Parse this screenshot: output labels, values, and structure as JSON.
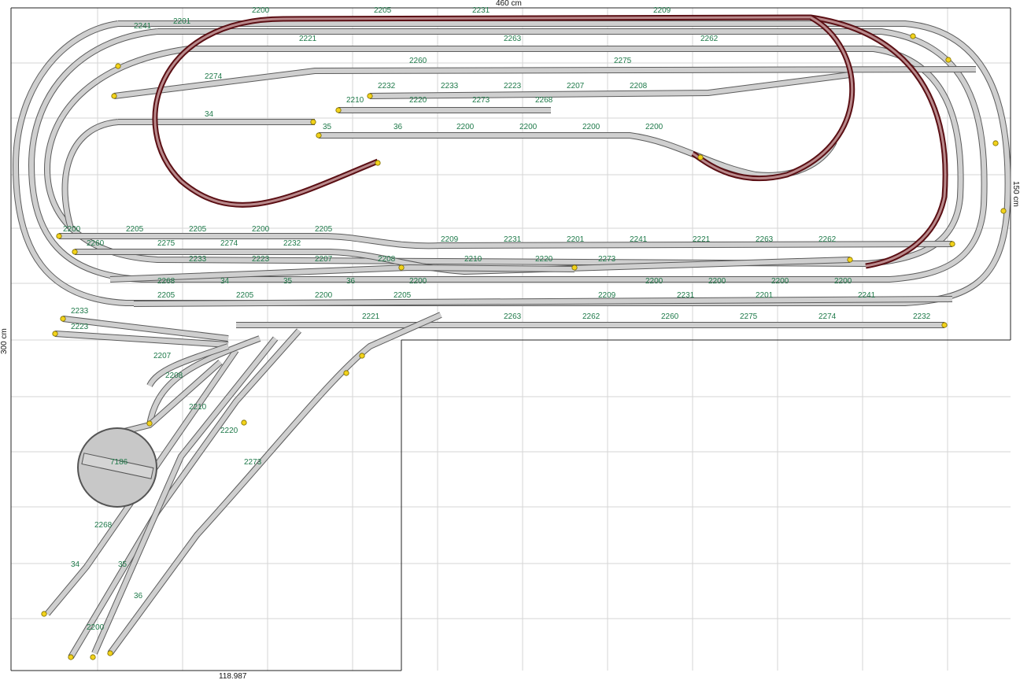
{
  "dimensions": {
    "width_label": "460 cm",
    "height_label": "300 cm",
    "right_label": "150 cm",
    "bottom_label": "118.987"
  },
  "turntable": {
    "label": "7186"
  },
  "piece_labels": [
    "2200",
    "2205",
    "2209",
    "2231",
    "2201",
    "2241",
    "2221",
    "2263",
    "2262",
    "2260",
    "2275",
    "2274",
    "2232",
    "2233",
    "2223",
    "2207",
    "2208",
    "2210",
    "2220",
    "2273",
    "2268",
    "34",
    "35",
    "36",
    "2200",
    "2200",
    "2200",
    "2200",
    "2200",
    "2205",
    "2205"
  ],
  "colors": {
    "label_green": "#1f7a4a",
    "track_fill": "#cfcfcf",
    "track_edge": "#5c5c5c",
    "mainline_red": "#5b0f14",
    "marker_yellow": "#f2d21b",
    "grid": "#d6d6d6"
  }
}
